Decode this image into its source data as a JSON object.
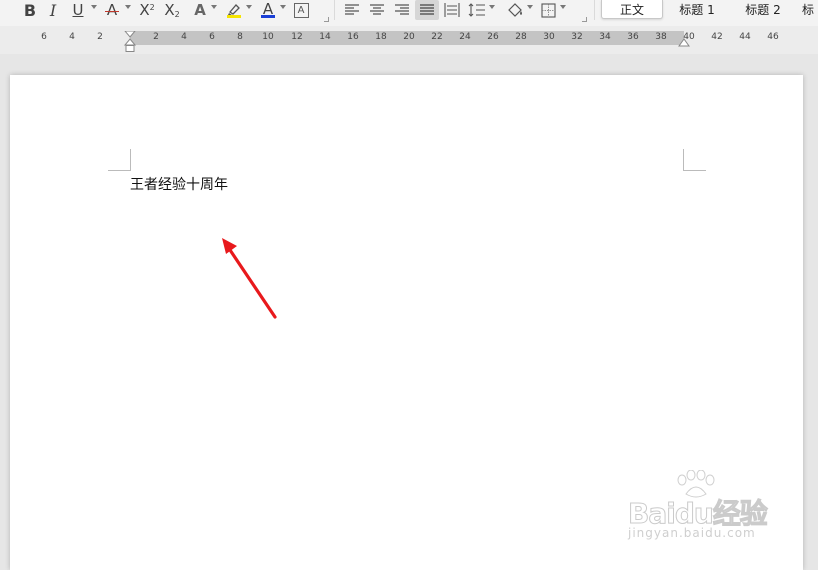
{
  "toolbar": {
    "bold": "B",
    "italic": "I",
    "underline": "U",
    "strikethrough": "A",
    "superscript": "X",
    "superscript_mark": "2",
    "subscript": "X",
    "subscript_mark": "2",
    "text_effect": "A",
    "font_color": "A",
    "char_border": "A",
    "styles": [
      "正文",
      "标题 1",
      "标题 2",
      "标"
    ]
  },
  "ruler": {
    "labels": [
      "6",
      "4",
      "2",
      "2",
      "4",
      "6",
      "8",
      "10",
      "12",
      "14",
      "16",
      "18",
      "20",
      "22",
      "24",
      "26",
      "28",
      "30",
      "32",
      "34",
      "36",
      "38",
      "40",
      "42",
      "44",
      "46"
    ]
  },
  "document": {
    "text": "王者经验十周年"
  },
  "watermark": {
    "brand": "Baidu经验",
    "url": "jingyan.baidu.com"
  },
  "colors": {
    "font_color_bar": "#1a3fd6",
    "highlight_bar": "#f5e400",
    "strike_red": "#c0392b",
    "arrow": "#e8191c"
  }
}
